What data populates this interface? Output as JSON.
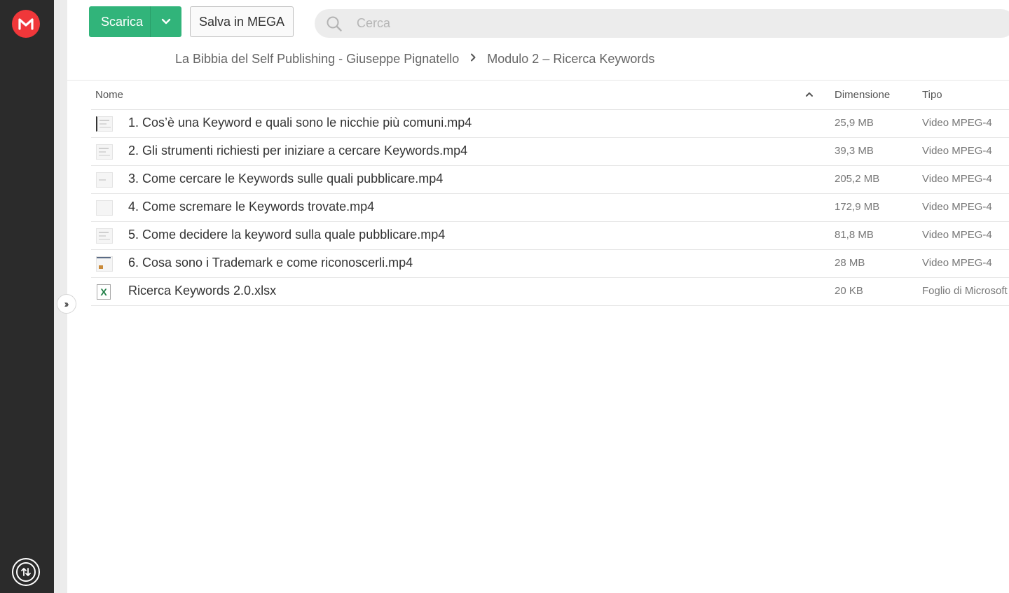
{
  "toolbar": {
    "download_label": "Scarica",
    "save_label": "Salva in MEGA"
  },
  "search": {
    "placeholder": "Cerca"
  },
  "breadcrumb": [
    "La Bibbia del Self Publishing - Giuseppe Pignatello",
    "Modulo 2 – Ricerca Keywords"
  ],
  "table": {
    "columns": {
      "name": "Nome",
      "size": "Dimensione",
      "type": "Tipo"
    },
    "rows": [
      {
        "name": "1. Cos’è una Keyword e quali sono le nicchie più comuni.mp4",
        "size": "25,9 MB",
        "type": "Video MPEG-4",
        "icon": "video-thumbnail"
      },
      {
        "name": "2. Gli strumenti richiesti per iniziare a cercare Keywords.mp4",
        "size": "39,3 MB",
        "type": "Video MPEG-4",
        "icon": "video-thumbnail"
      },
      {
        "name": "3. Come cercare le Keywords sulle quali pubblicare.mp4",
        "size": "205,2 MB",
        "type": "Video MPEG-4",
        "icon": "video-thumbnail"
      },
      {
        "name": "4. Come scremare le Keywords trovate.mp4",
        "size": "172,9 MB",
        "type": "Video MPEG-4",
        "icon": "video-thumbnail"
      },
      {
        "name": "5. Come decidere la keyword sulla quale pubblicare.mp4",
        "size": "81,8 MB",
        "type": "Video MPEG-4",
        "icon": "video-thumbnail"
      },
      {
        "name": "6. Cosa sono i Trademark e come riconoscerli.mp4",
        "size": "28 MB",
        "type": "Video MPEG-4",
        "icon": "video-thumbnail"
      },
      {
        "name": "Ricerca Keywords 2.0.xlsx",
        "size": "20 KB",
        "type": "Foglio di Microsoft",
        "icon": "excel-icon"
      }
    ]
  },
  "colors": {
    "accent_green": "#31b47a",
    "logo_red": "#f0373a",
    "rail_dark": "#2b2b2b"
  }
}
